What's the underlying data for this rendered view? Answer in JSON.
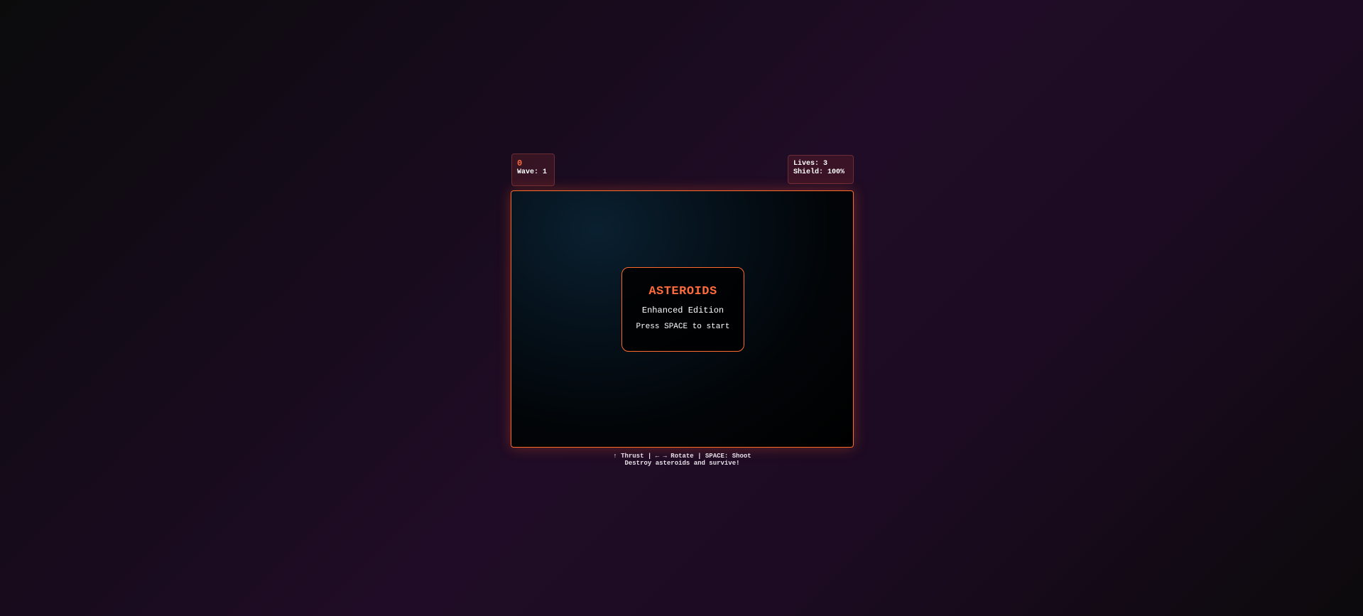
{
  "hud": {
    "score": "0",
    "wave": "Wave: 1",
    "lives": "Lives: 3",
    "shield": "Shield: 100%"
  },
  "overlay": {
    "title": "ASTEROIDS",
    "subtitle": "Enhanced Edition",
    "prompt": "Press SPACE to start"
  },
  "instructions": {
    "controls": "↑ Thrust | ← → Rotate | SPACE: Shoot",
    "goal": "Destroy asteroids and survive!"
  },
  "colors": {
    "accent": "#ff6a2b",
    "title": "#ff6a3d"
  }
}
